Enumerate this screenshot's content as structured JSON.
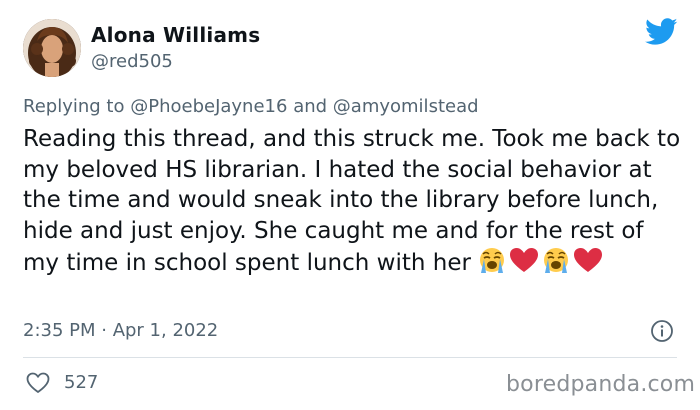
{
  "author": {
    "display_name": "Alona Williams",
    "handle": "@red505",
    "avatar_icon": "profile-photo"
  },
  "brand": {
    "icon": "twitter-bird-icon",
    "color": "#1d9bf0"
  },
  "reply": {
    "prefix": "Replying to",
    "mention_1": "@PhoebeJayne16",
    "conjunction": "and",
    "mention_2": "@amyomilstead"
  },
  "tweet": {
    "text": "Reading this thread, and this struck me. Took me back to my beloved HS librarian. I hated the social behavior at the time and would sneak into the library before lunch, hide and just enjoy. She caught me and for the rest of my time in school spent lunch with her",
    "emojis": [
      "loudly-crying-face",
      "red-heart",
      "loudly-crying-face",
      "red-heart"
    ]
  },
  "meta": {
    "timestamp": "2:35 PM · Apr 1, 2022",
    "info_icon": "info-icon"
  },
  "stats": {
    "likes": "527",
    "like_icon": "heart-outline-icon"
  },
  "watermark": "boredpanda.com"
}
